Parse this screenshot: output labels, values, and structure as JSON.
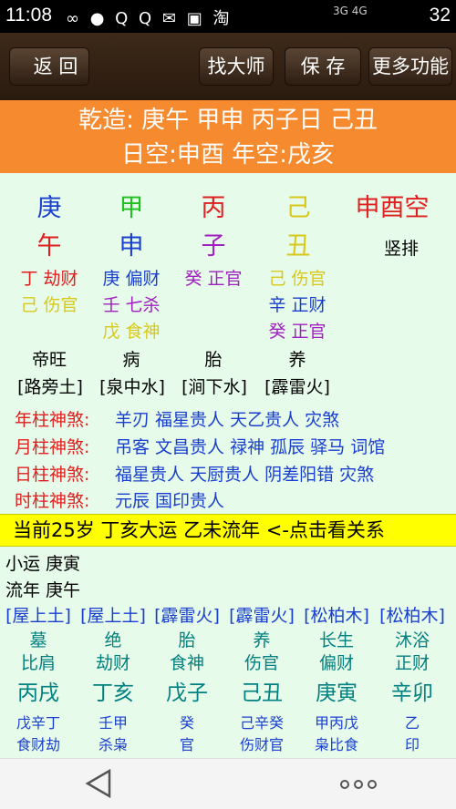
{
  "status": {
    "time": "11:08",
    "battery": "32",
    "icons": "∞ ● Q Q ✉ ▣ 淘",
    "net": "3G 4G"
  },
  "toolbar": {
    "back": "返 回",
    "master": "找大师",
    "save": "保 存",
    "more": "更多功能"
  },
  "banner": {
    "line1": "乾造: 庚午 甲申 丙子日 己丑",
    "line2": "日空:申酉 年空:戌亥"
  },
  "pillars": {
    "stems": [
      "庚",
      "甲",
      "丙",
      "己"
    ],
    "branches": [
      "午",
      "申",
      "子",
      "丑"
    ],
    "kong": "申酉空",
    "layout": "竖排",
    "hidden": [
      [
        "丁 劫财",
        "己 伤官",
        ""
      ],
      [
        "庚 偏财",
        "壬 七杀",
        "戊 食神"
      ],
      [
        "癸 正官",
        "",
        ""
      ],
      [
        "己 伤官",
        "辛 正财",
        "癸 正官"
      ]
    ],
    "phases": [
      "帝旺",
      "病",
      "胎",
      "养"
    ],
    "nayin": [
      "[路旁土]",
      "[泉中水]",
      "[涧下水]",
      "[霹雷火]"
    ]
  },
  "shensha": [
    {
      "label": "年柱神煞:",
      "value": "羊刃 福星贵人 天乙贵人 灾煞"
    },
    {
      "label": "月柱神煞:",
      "value": "吊客 文昌贵人 禄神 孤辰 驿马 词馆"
    },
    {
      "label": "日柱神煞:",
      "value": "福星贵人 天厨贵人 阴差阳错 灾煞"
    },
    {
      "label": "时柱神煞:",
      "value": "元辰 国印贵人"
    }
  ],
  "current": "当前25岁 丁亥大运 乙未流年  <-点击看关系",
  "xiaoyun": "小运  庚寅",
  "liunian": "流年  庚午",
  "luck_nayin": [
    "[屋上土]",
    "[屋上土]",
    "[霹雷火]",
    "[霹雷火]",
    "[松柏木]",
    "[松柏木]"
  ],
  "luck_phase": [
    "墓",
    "绝",
    "胎",
    "养",
    "长生",
    "沐浴"
  ],
  "luck_god": [
    "比肩",
    "劫财",
    "食神",
    "伤官",
    "偏财",
    "正财"
  ],
  "luck_gz": [
    "丙戌",
    "丁亥",
    "戊子",
    "己丑",
    "庚寅",
    "辛卯"
  ],
  "luck_hidden": [
    "戊辛丁",
    "壬甲",
    "癸",
    "己辛癸",
    "甲丙戊",
    "乙"
  ],
  "luck_hidden_god": [
    "食财劫",
    "杀枭",
    "官",
    "伤财官",
    "枭比食",
    "印"
  ],
  "colors": {
    "stem": [
      "#1a3fd0",
      "#1fbf1f",
      "#e02020",
      "#d8c81a"
    ],
    "branch": [
      "#e02020",
      "#1a3fd0",
      "#a020c0",
      "#d8c81a"
    ]
  }
}
